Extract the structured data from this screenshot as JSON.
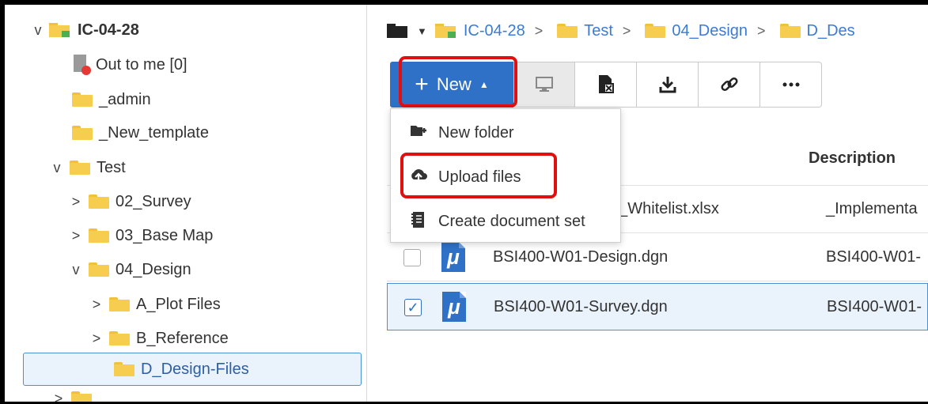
{
  "tree": {
    "items": [
      {
        "label": "IC-04-28",
        "chevron": "v"
      },
      {
        "label": "Out to me [0]"
      },
      {
        "label": "_admin"
      },
      {
        "label": "_New_template"
      },
      {
        "label": "Test",
        "chevron": "v"
      },
      {
        "label": "02_Survey",
        "chevron": ">"
      },
      {
        "label": "03_Base Map",
        "chevron": ">"
      },
      {
        "label": "04_Design",
        "chevron": "v"
      },
      {
        "label": "A_Plot Files",
        "chevron": ">"
      },
      {
        "label": "B_Reference",
        "chevron": ">"
      },
      {
        "label": "D_Design-Files"
      }
    ]
  },
  "breadcrumb": {
    "items": [
      "IC-04-28",
      "Test",
      "04_Design",
      "D_Des"
    ],
    "separator": ">"
  },
  "toolbar": {
    "new_label": "New",
    "new_plus": "+",
    "new_caret": "▲"
  },
  "new_menu": {
    "items": [
      {
        "label": "New folder",
        "icon": "new-folder-icon"
      },
      {
        "label": "Upload files",
        "icon": "upload-cloud-icon"
      },
      {
        "label": "Create document set",
        "icon": "document-set-icon"
      }
    ]
  },
  "table": {
    "description_header": "Description",
    "rows": [
      {
        "name": "n_Whitelist.xlsx",
        "description": "_Implementa",
        "checked": false
      },
      {
        "name": "BSI400-W01-Design.dgn",
        "description": "BSI400-W01-",
        "checked": false
      },
      {
        "name": "BSI400-W01-Survey.dgn",
        "description": "BSI400-W01-",
        "checked": true
      }
    ]
  },
  "colors": {
    "accent": "#2f71c6",
    "highlight": "#e01010",
    "folder": "#f6cd4f",
    "selection_bg": "#eaf3fc"
  }
}
